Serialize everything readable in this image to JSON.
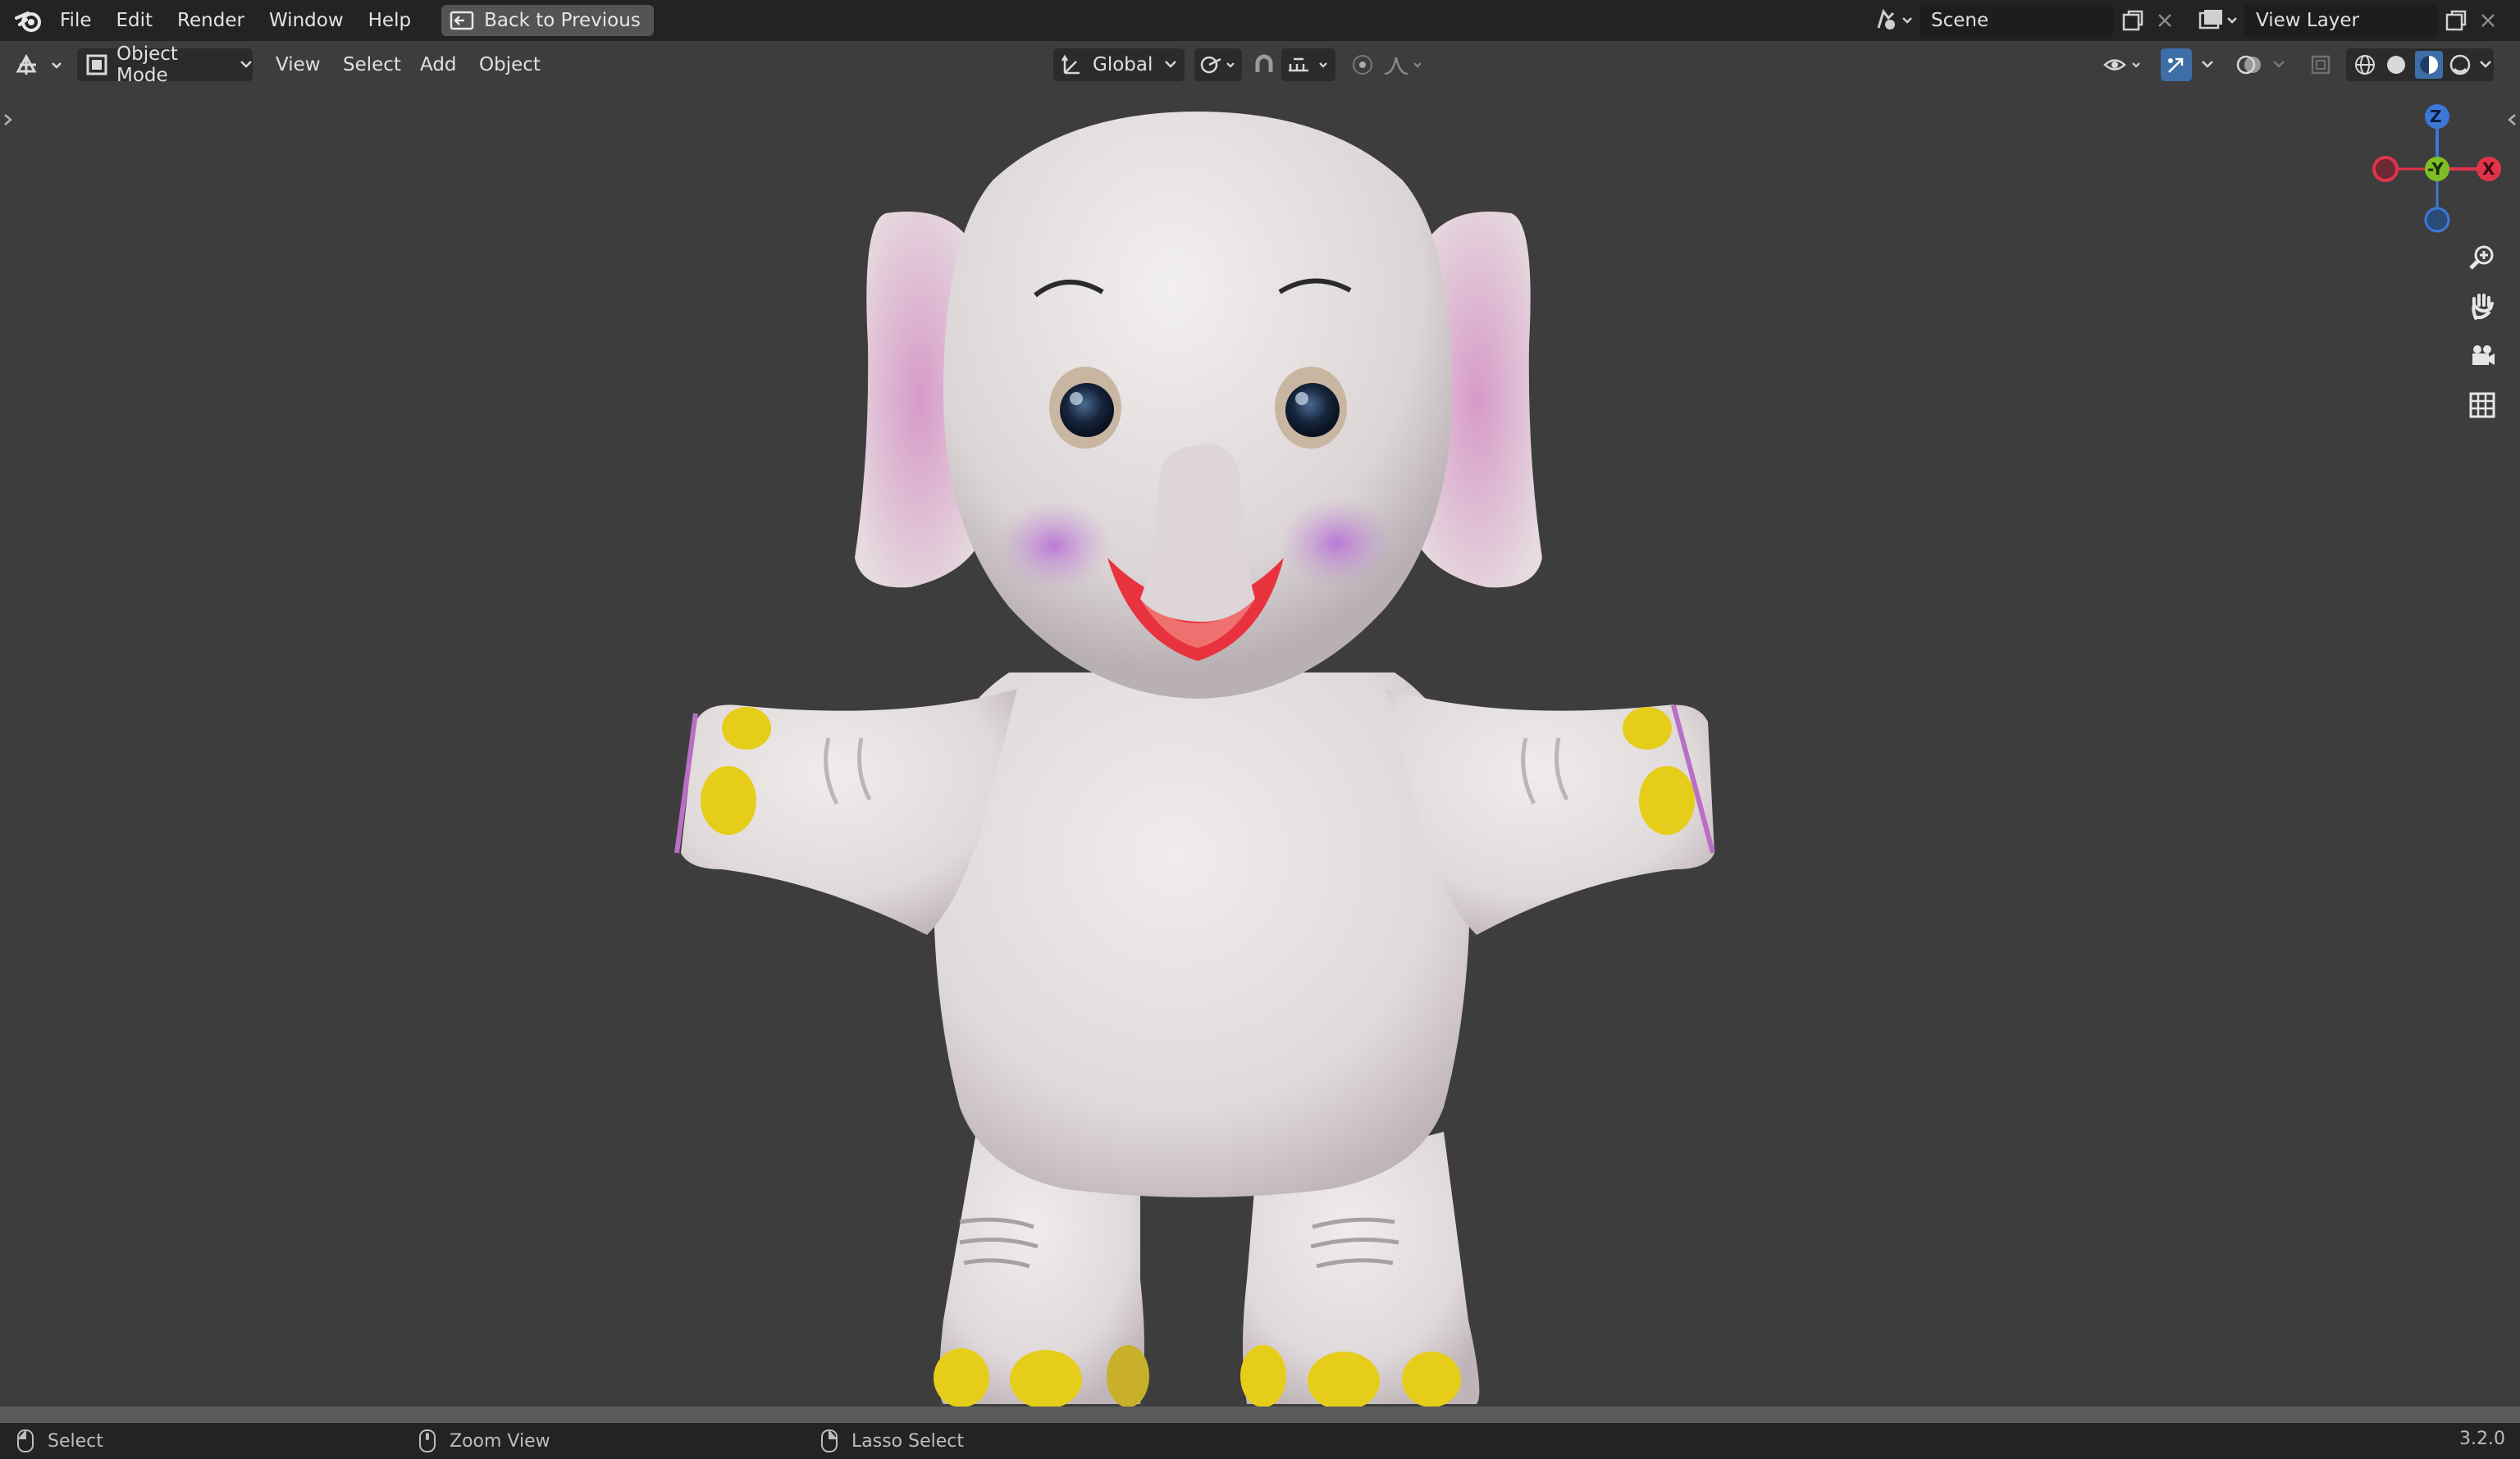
{
  "menu": {
    "items": [
      "File",
      "Edit",
      "Render",
      "Window",
      "Help"
    ],
    "back_button": "Back to Previous"
  },
  "topright": {
    "scene": "Scene",
    "view_layer": "View Layer"
  },
  "header": {
    "mode": "Object Mode",
    "menus": [
      "View",
      "Select",
      "Add",
      "Object"
    ],
    "orientation": "Global"
  },
  "gizmo": {
    "z": "Z",
    "y": "-Y",
    "x": "X"
  },
  "status": {
    "left": "Select",
    "middle": "Zoom View",
    "right": "Lasso Select",
    "version": "3.2.0"
  },
  "colors": {
    "x_axis": "#e0344b",
    "y_axis": "#7fbf26",
    "z_axis": "#3c78d8",
    "active_button": "#3d6ea8"
  }
}
